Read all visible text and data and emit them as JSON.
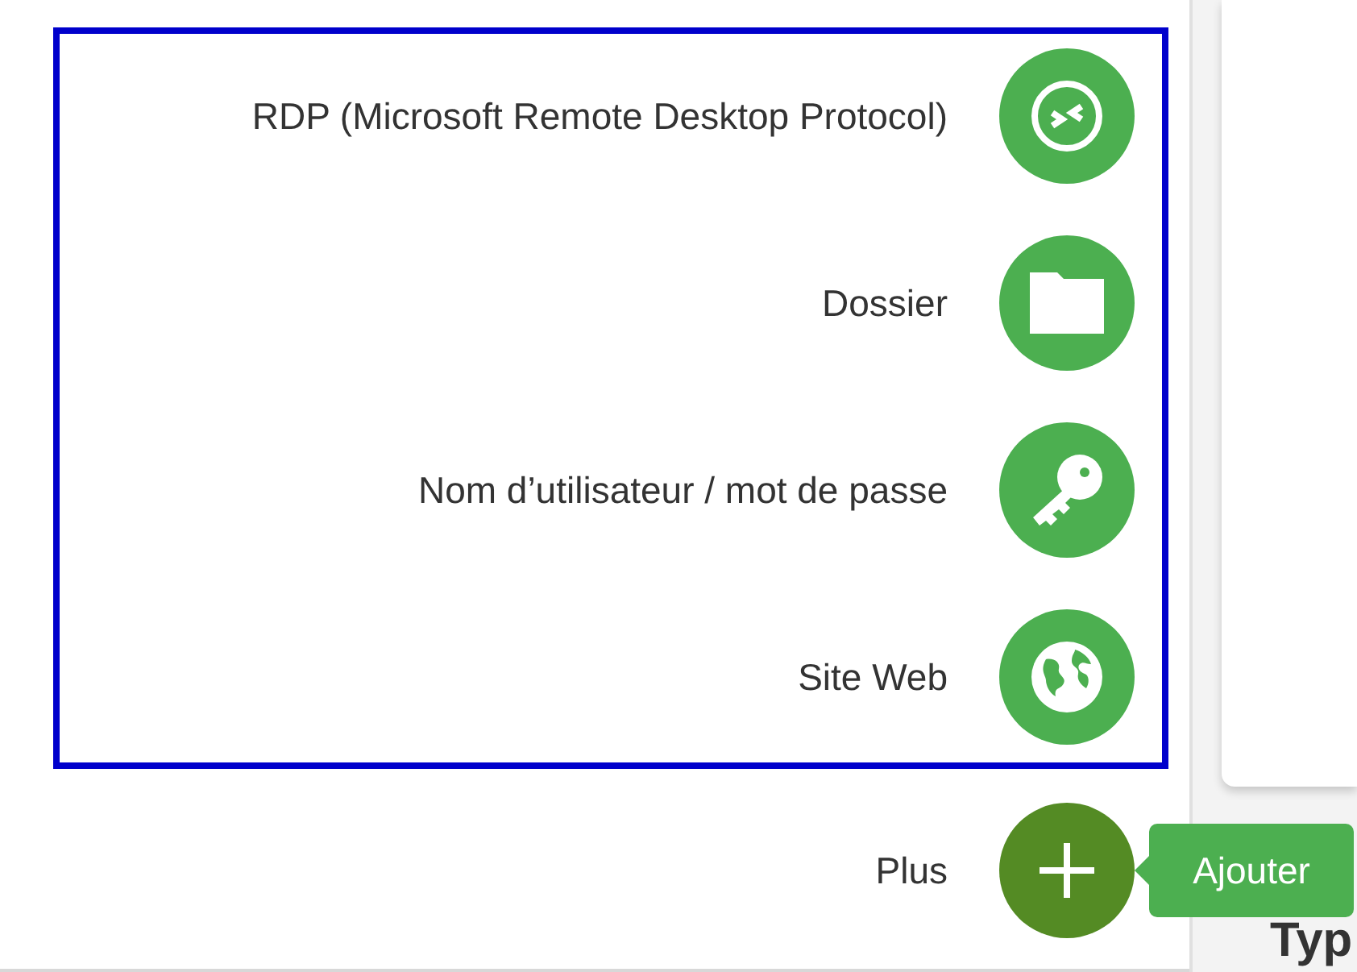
{
  "fab_menu": {
    "items": [
      {
        "label": "RDP (Microsoft Remote Desktop Protocol)",
        "kind": "rdp"
      },
      {
        "label": "Dossier",
        "kind": "folder"
      },
      {
        "label": "Nom d’utilisateur / mot de passe",
        "kind": "key"
      },
      {
        "label": "Site Web",
        "kind": "globe"
      }
    ],
    "main": {
      "label": "Plus",
      "tooltip": "Ajouter"
    }
  },
  "side_heading": "Typ"
}
